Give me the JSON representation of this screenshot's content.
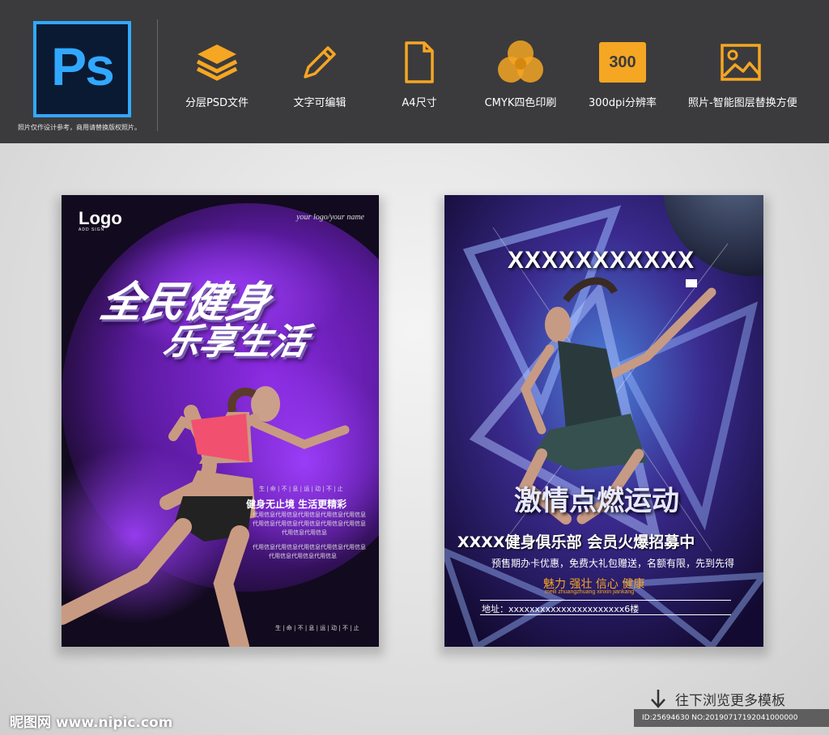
{
  "header": {
    "app_logo_text": "Ps",
    "note": "照片仅作设计参考，商用请替换版权照片。",
    "features": [
      {
        "icon": "layers-icon",
        "label": "分层PSD文件"
      },
      {
        "icon": "pencil-icon",
        "label": "文字可编辑"
      },
      {
        "icon": "document-icon",
        "label": "A4尺寸"
      },
      {
        "icon": "cmyk-circles-icon",
        "label": "CMYK四色印刷"
      },
      {
        "icon": "dpi-badge-icon",
        "label": "300dpi分辨率",
        "badge": "300"
      },
      {
        "icon": "image-icon",
        "label": "照片-智能图层替换方便"
      }
    ]
  },
  "poster_left": {
    "logo": "Logo",
    "logo_sub": "ADD SIGN",
    "your_logo": "your logo/your name",
    "title_line1": "全民健身",
    "title_line2": "乐享生活",
    "small_line": "生 | 命 | 不 | 息 | 运 | 动 | 不 | 止",
    "slogan": "健身无止境 生活更精彩",
    "body_line1": "代用信息代用信息代用信息代用信息代用信息",
    "body_line2": "代用信息代用信息代用信息代用信息代用信息",
    "body_line3": "代用信息代用信息",
    "body_line4": "代用信息代用信息代用信息代用信息代用信息",
    "body_line5": "代用信息代用信息代用信息",
    "bottom_line": "生 | 命 | 不 | 息 | 运 | 动 | 不 | 止"
  },
  "poster_right": {
    "x_title": "XXXXXXXXXXX",
    "headline": "激情点燃运动",
    "club": "XXXX健身俱乐部    会员火爆招募中",
    "promo": "预售期办卡优惠，免费大礼包赠送，名额有限，先到先得",
    "tags": "魅力 强壮 信心 健康",
    "tags_pinyin": "meili zhuangzhuang xinxin jiankang",
    "address": "地址：xxxxxxxxxxxxxxxxxxxxxx6楼"
  },
  "footer": {
    "site_logo": "昵图网 www.nipic.com",
    "more_label": "往下浏览更多模板",
    "id_text": "ID:25694630 NO:20190717192041000000"
  },
  "colors": {
    "accent": "#f5a623",
    "ps_blue": "#31a8ff",
    "bar": "#3b3b3d"
  }
}
